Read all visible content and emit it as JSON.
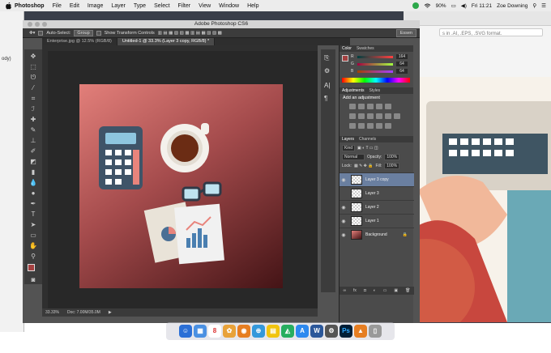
{
  "menubar": {
    "app": "Photoshop",
    "items": [
      "File",
      "Edit",
      "Image",
      "Layer",
      "Type",
      "Select",
      "Filter",
      "View",
      "Window",
      "Help"
    ],
    "battery": "90%",
    "clock": "Fri 11:21",
    "user": "Zoe Downing"
  },
  "browser": {
    "format_text": "s in .AI, .EPS, .SVG format.",
    "left_label": "ody)"
  },
  "photoshop": {
    "title": "Adobe Photoshop CS6",
    "options": {
      "auto_select": "Auto-Select:",
      "group": "Group",
      "show_transform": "Show Transform Controls",
      "essentials": "Essen"
    },
    "tabs": [
      {
        "label": "Enterprise.jpg @ 12.5% (RGB/8)",
        "active": false
      },
      {
        "label": "Untitled-1 @ 33.3% (Layer 3 copy, RGB/8) *",
        "active": true
      }
    ],
    "status": {
      "zoom": "33.33%",
      "doc": "Doc: 7.00M/35.0M"
    }
  },
  "panels": {
    "color": {
      "tabs": [
        "Color",
        "Swatches"
      ],
      "r_label": "R",
      "g_label": "G",
      "b_label": "B",
      "r": "164",
      "g": "64",
      "b": "64"
    },
    "adjustments": {
      "tabs": [
        "Adjustments",
        "Styles"
      ],
      "title": "Add an adjustment"
    },
    "layers": {
      "tabs": [
        "Layers",
        "Channels"
      ],
      "kind": "Kind",
      "blend": "Normal",
      "opacity_label": "Opacity:",
      "opacity": "100%",
      "lock_label": "Lock:",
      "fill_label": "Fill:",
      "fill": "100%",
      "items": [
        {
          "name": "Layer 3 copy",
          "selected": true
        },
        {
          "name": "Layer 3",
          "selected": false
        },
        {
          "name": "Layer 2",
          "selected": false
        },
        {
          "name": "Layer 1",
          "selected": false
        },
        {
          "name": "Background",
          "selected": false
        }
      ]
    }
  },
  "colors": {
    "accent_selection": "#6a7fa0",
    "foreground_swatch": "#a44040",
    "canvas_top": "#e27f7a",
    "canvas_bottom": "#441416"
  }
}
